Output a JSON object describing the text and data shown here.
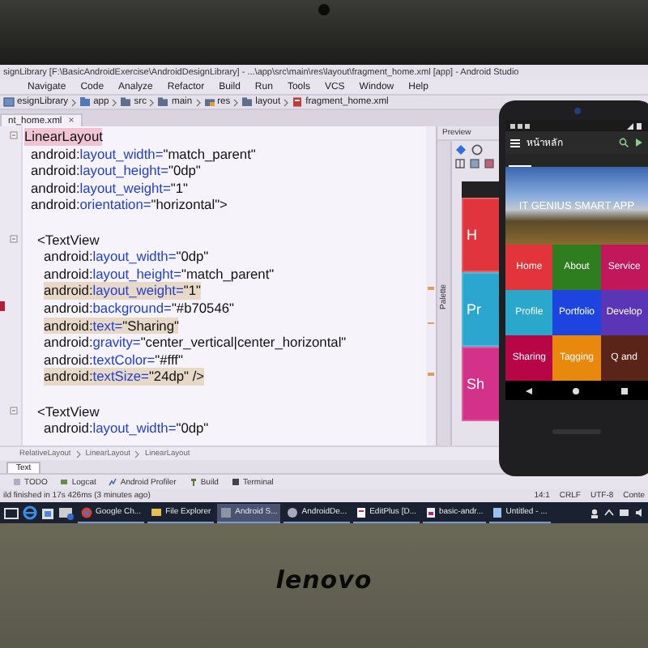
{
  "window": {
    "title": "signLibrary [F:\\BasicAndroidExercise\\AndroidDesignLibrary] - ...\\app\\src\\main\\res\\layout\\fragment_home.xml [app] - Android Studio"
  },
  "menu": [
    "Navigate",
    "Code",
    "Analyze",
    "Refactor",
    "Build",
    "Run",
    "Tools",
    "VCS",
    "Window",
    "Help"
  ],
  "breadcrumbs": [
    {
      "label": "esignLibrary",
      "kind": "project"
    },
    {
      "label": "app",
      "kind": "module"
    },
    {
      "label": "src",
      "kind": "folder"
    },
    {
      "label": "main",
      "kind": "folder"
    },
    {
      "label": "res",
      "kind": "resfolder"
    },
    {
      "label": "layout",
      "kind": "folder"
    },
    {
      "label": "fragment_home.xml",
      "kind": "file"
    }
  ],
  "editor_tab": {
    "label": "nt_home.xml",
    "close": "×"
  },
  "code": {
    "elements": [
      {
        "tag": "LinearLayout",
        "tag_highlighted": true,
        "attributes": [
          {
            "ns": "android:",
            "name": "layout_width=",
            "value": "\"match_parent\"",
            "highlighted": false
          },
          {
            "ns": "android:",
            "name": "layout_height=",
            "value": "\"0dp\"",
            "highlighted": false
          },
          {
            "ns": "android:",
            "name": "layout_weight=",
            "value": "\"1\"",
            "highlighted": false
          },
          {
            "ns": "android:",
            "name": "orientation=",
            "value": "\"horizontal\">",
            "highlighted": false
          }
        ],
        "children": [
          {
            "tag": "<TextView",
            "tag_highlighted": false,
            "attributes": [
              {
                "ns": "android:",
                "name": "layout_width=",
                "value": "\"0dp\"",
                "highlighted": false
              },
              {
                "ns": "android:",
                "name": "layout_height=",
                "value": "\"match_parent\"",
                "highlighted": false
              },
              {
                "ns": "android:",
                "name": "layout_weight=",
                "value": "\"1\"",
                "highlighted": true
              },
              {
                "ns": "android:",
                "name": "background=",
                "value": "\"#b70546\"",
                "highlighted": false
              },
              {
                "ns": "android:",
                "name": "text=",
                "value": "\"Sharing\"",
                "highlighted": true
              },
              {
                "ns": "android:",
                "name": "gravity=",
                "value": "\"center_vertical|center_horizontal\"",
                "highlighted": false
              },
              {
                "ns": "android:",
                "name": "textColor=",
                "value": "\"#fff\"",
                "highlighted": false
              },
              {
                "ns": "android:",
                "name": "textSize=",
                "value": "\"24dp\" />",
                "highlighted": true
              }
            ]
          },
          {
            "tag": "<TextView",
            "tag_highlighted": false,
            "attributes": [
              {
                "ns": "android:",
                "name": "layout_width=",
                "value": "\"0dp\"",
                "highlighted": false
              }
            ]
          }
        ]
      }
    ]
  },
  "structure_path": [
    "RelativeLayout",
    "LinearLayout",
    "LinearLayout"
  ],
  "editor_mode_tabs": [
    {
      "label": "Text",
      "selected": true
    }
  ],
  "tool_windows": [
    {
      "label": "TODO",
      "kind": "todo"
    },
    {
      "label": "Logcat",
      "kind": "logcat"
    },
    {
      "label": "Android Profiler",
      "kind": "profiler"
    },
    {
      "label": "Build",
      "kind": "build"
    },
    {
      "label": "Terminal",
      "kind": "terminal"
    }
  ],
  "status": {
    "message": "ild finished in 17s 426ms (3 minutes ago)",
    "position": "14:1",
    "line_separator": "CRLF",
    "encoding": "UTF-8",
    "context": "Conte"
  },
  "preview": {
    "title": "Preview",
    "side_tab": "Palette",
    "tiles": [
      {
        "label": "H",
        "color": "#e0353c"
      },
      {
        "label": "Pr",
        "color": "#2aa6cf"
      },
      {
        "label": "Sh",
        "color": "#d4328a"
      }
    ]
  },
  "phone": {
    "app_title": "หน้าหลัก",
    "banner_text": "IT GENIUS SMART APP",
    "tiles": [
      {
        "label": "Home",
        "color": "#e2343a"
      },
      {
        "label": "About",
        "color": "#2e7d1e"
      },
      {
        "label": "Service",
        "color": "#c2185b"
      },
      {
        "label": "Profile",
        "color": "#29a8cc"
      },
      {
        "label": "Portfolio",
        "color": "#1e44e0"
      },
      {
        "label": "Develop",
        "color": "#5a35b5"
      },
      {
        "label": "Sharing",
        "color": "#b70546"
      },
      {
        "label": "Tagging",
        "color": "#e8880c"
      },
      {
        "label": "Q and",
        "color": "#5a2418"
      }
    ]
  },
  "taskbar": {
    "items": [
      {
        "label": "Google Ch...",
        "kind": "chrome",
        "selected": false
      },
      {
        "label": "File Explorer",
        "kind": "explorer",
        "selected": false
      },
      {
        "label": "Android S...",
        "kind": "studio",
        "selected": true
      },
      {
        "label": "AndroidDe...",
        "kind": "studio2",
        "selected": false
      },
      {
        "label": "EditPlus [D...",
        "kind": "editor",
        "selected": false
      },
      {
        "label": "basic-andr...",
        "kind": "document",
        "selected": false
      },
      {
        "label": "Untitled - ...",
        "kind": "notepad",
        "selected": false
      }
    ]
  },
  "laptop": {
    "brand": "lenovo"
  }
}
